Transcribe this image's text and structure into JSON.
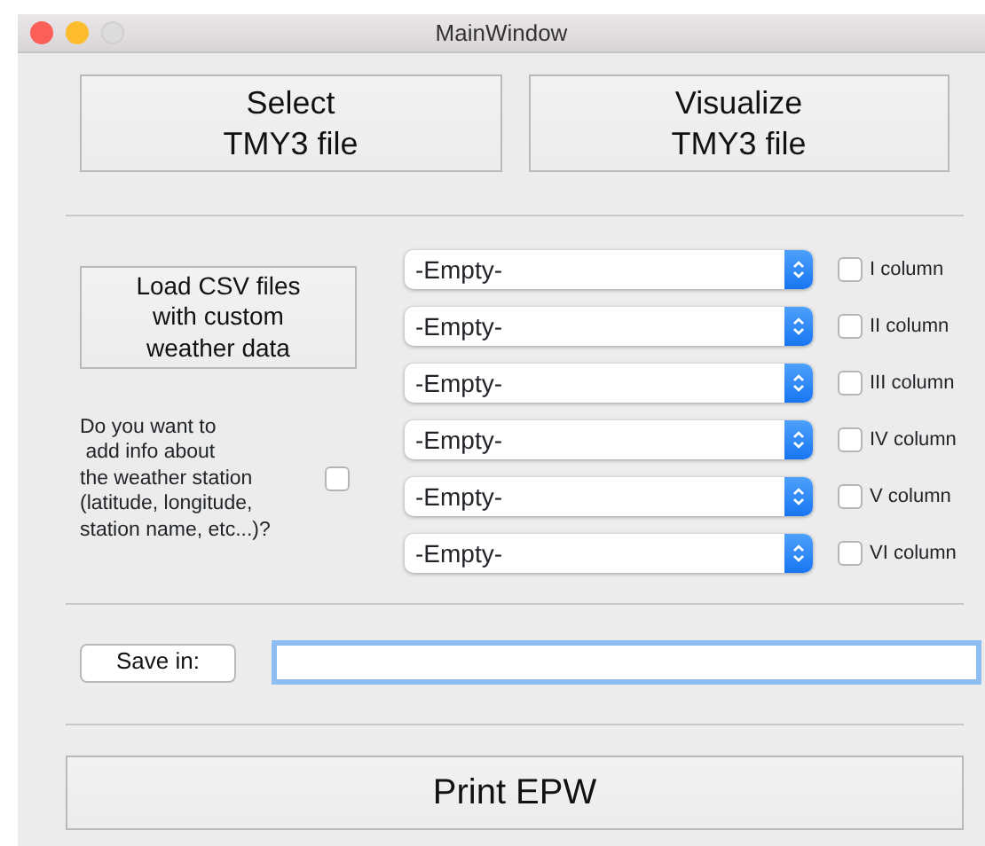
{
  "window": {
    "title": "MainWindow"
  },
  "top_buttons": [
    "Select\nTMY3 file",
    "Visualize\nTMY3 file"
  ],
  "load_button": "Load CSV files\nwith custom\nweather data",
  "station_question": {
    "text": "Do you want to\n add info about\nthe weather station\n(latitude, longitude,\nstation name, etc...)?",
    "checked": false
  },
  "columns": [
    {
      "value": "-Empty-",
      "label": "I column",
      "checked": false
    },
    {
      "value": "-Empty-",
      "label": "II column",
      "checked": false
    },
    {
      "value": "-Empty-",
      "label": "III column",
      "checked": false
    },
    {
      "value": "-Empty-",
      "label": "IV column",
      "checked": false
    },
    {
      "value": "-Empty-",
      "label": "V column",
      "checked": false
    },
    {
      "value": "-Empty-",
      "label": "VI column",
      "checked": false
    }
  ],
  "save_button": "Save in:",
  "path_field": {
    "focused": true
  },
  "print_button": "Print EPW"
}
